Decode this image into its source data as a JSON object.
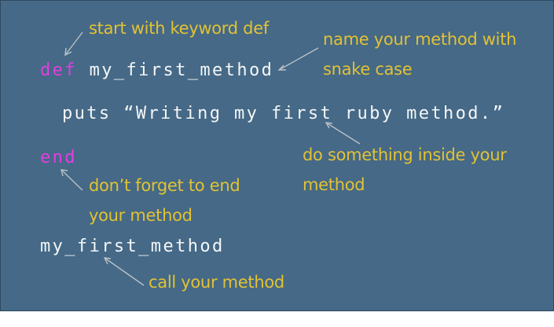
{
  "code": {
    "keyword_def": "def",
    "method_name": "my_first_method",
    "body_line": "puts “Writing my first ruby method.”",
    "keyword_end": "end",
    "call_line": "my_first_method"
  },
  "annotations": {
    "def_note": "start with keyword def",
    "snake_note_line1": "name your method with",
    "snake_note_line2": "snake case",
    "body_note_line1": "do something inside your",
    "body_note_line2": "method",
    "end_note_line1": "don’t forget to end",
    "end_note_line2": "your method",
    "call_note": "call your method"
  },
  "colors": {
    "background": "#456986",
    "keyword": "#e23ee2",
    "code_text": "#f4f6f8",
    "annotation": "#e2c234",
    "arrow": "#b9c0c7"
  }
}
